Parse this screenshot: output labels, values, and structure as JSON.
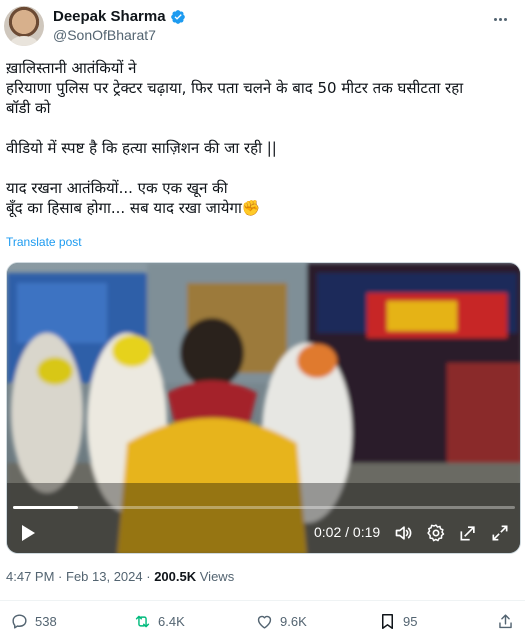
{
  "author": {
    "name": "Deepak Sharma",
    "handle": "@SonOfBharat7",
    "verified": true
  },
  "tweet": {
    "text": "ख़ालिस्तानी आतंकियों ने\nहरियाणा पुलिस पर ट्रेक्टर चढ़ाया, फिर पता चलने के बाद 50 मीटर तक घसीटता रहा\nबॉडी को\n\nवीडियो में स्पष्ट है कि हत्या साज़िशन की जा रही ||\n\nयाद रखना आतंकियों... एक एक खून की\n बूँद का हिसाब होगा... सब याद रखा जायेगा✊",
    "translate_label": "Translate post"
  },
  "video": {
    "current_time": "0:02",
    "duration": "0:19",
    "time_display": "0:02 / 0:19",
    "progress": 0.13,
    "icons": [
      "play-icon",
      "volume-icon",
      "settings-icon",
      "pop-out-icon",
      "fullscreen-icon"
    ]
  },
  "meta": {
    "time": "4:47 PM",
    "date": "Feb 13, 2024",
    "views_count": "200.5K",
    "views_label": "Views"
  },
  "actions": {
    "replies": "538",
    "reposts": "6.4K",
    "likes": "9.6K",
    "bookmarks": "95"
  },
  "colors": {
    "accent": "#1d9bf0",
    "text_primary": "#0f1419",
    "text_secondary": "#536471",
    "verified": "#1d9bf0",
    "repost_icon": "#00ba7c"
  }
}
